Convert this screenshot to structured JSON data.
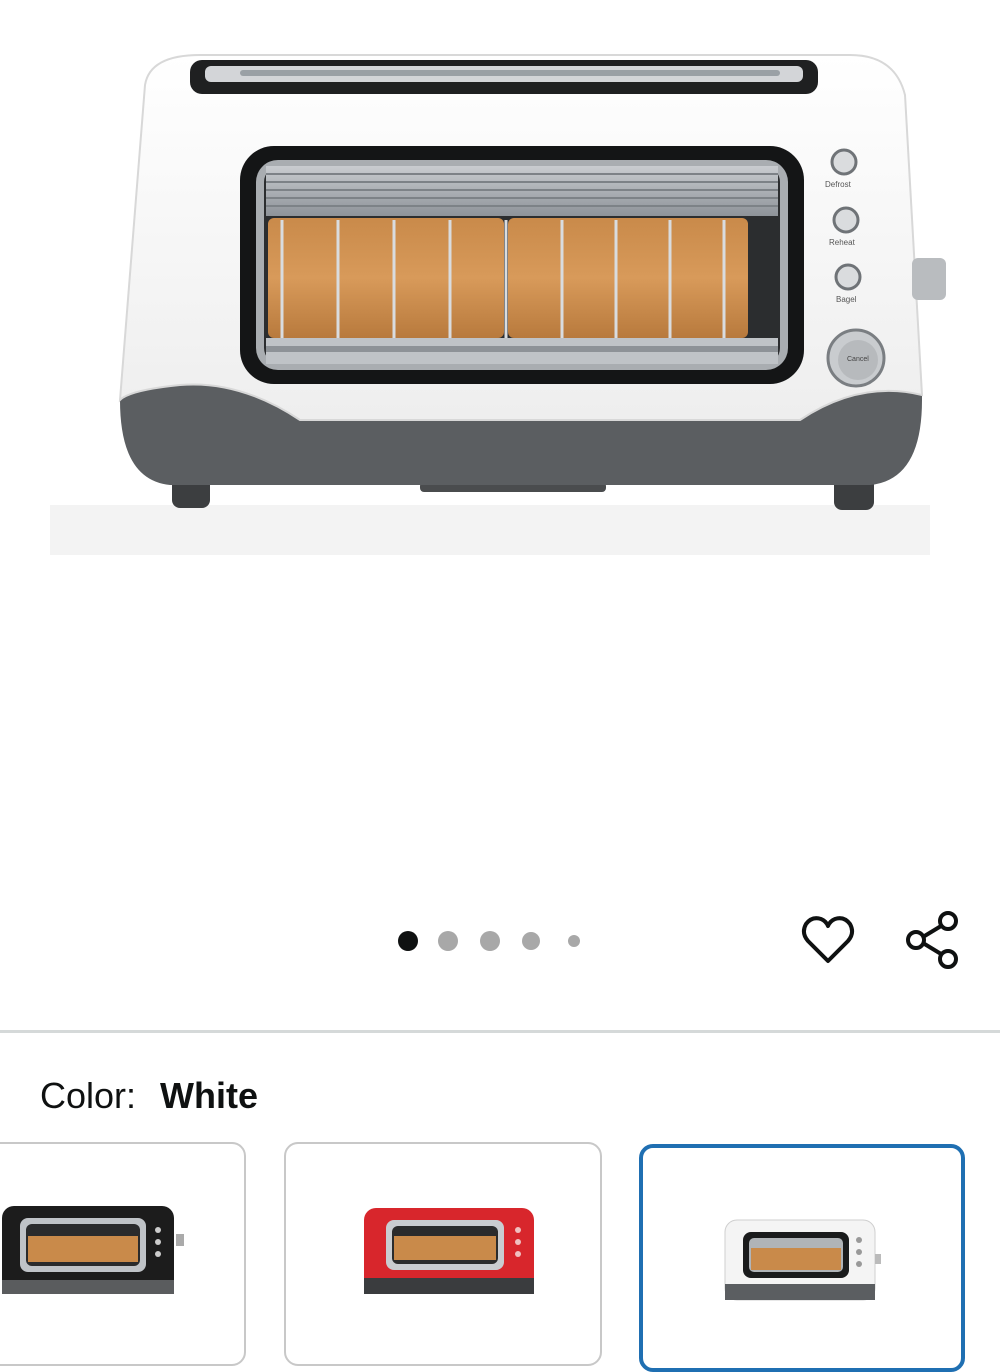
{
  "product": {
    "image_alt": "Toaster product image",
    "controls": [
      "Defrost",
      "Reheat",
      "Bagel",
      "Cancel"
    ]
  },
  "carousel": {
    "count": 5,
    "active_index": 0
  },
  "color": {
    "label": "Color:",
    "selected": "White"
  },
  "swatches": [
    {
      "name": "Black",
      "body": "#1c1c1c"
    },
    {
      "name": "Red",
      "body": "#d8262c"
    },
    {
      "name": "White",
      "body": "#f4f4f4",
      "selected": true
    }
  ],
  "colors": {
    "accent": "#1f6fb2",
    "divider": "#d5d9d9",
    "text": "#0f1111"
  },
  "icons": {
    "wishlist": "heart-icon",
    "share": "share-icon"
  }
}
